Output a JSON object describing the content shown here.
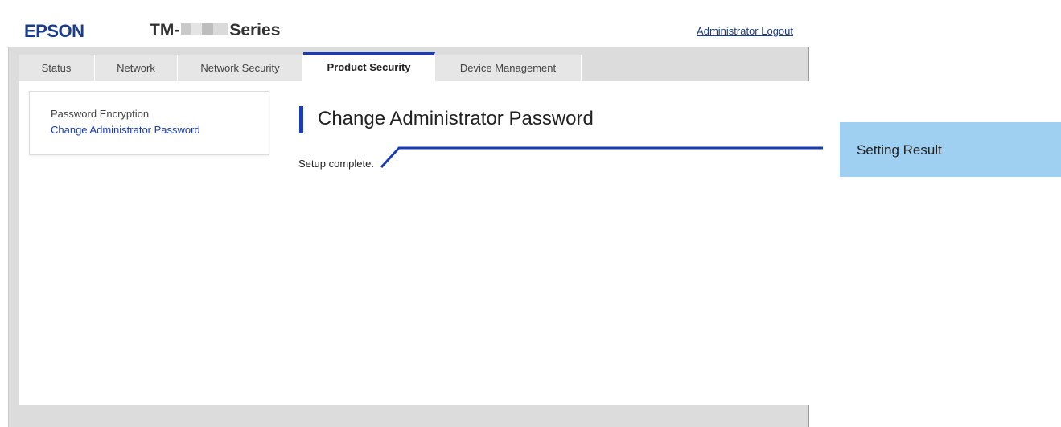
{
  "header": {
    "brand": "EPSON",
    "model_prefix": "TM-",
    "model_suffix": "Series",
    "logout_label": "Administrator Logout"
  },
  "tabs": [
    {
      "label": "Status",
      "active": false
    },
    {
      "label": "Network",
      "active": false
    },
    {
      "label": "Network Security",
      "active": false
    },
    {
      "label": "Product Security",
      "active": true
    },
    {
      "label": "Device Management",
      "active": false
    }
  ],
  "sidebar": {
    "items": [
      {
        "label": "Password Encryption"
      },
      {
        "label": "Change Administrator Password"
      }
    ]
  },
  "main": {
    "title": "Change Administrator Password",
    "result": "Setup complete."
  },
  "callout": {
    "label": "Setting Result"
  },
  "colors": {
    "brand": "#1a3c8c",
    "accent": "#1a3cb4",
    "callout_bg": "#9fd0f1",
    "panel_bg": "#dcdcdc"
  }
}
